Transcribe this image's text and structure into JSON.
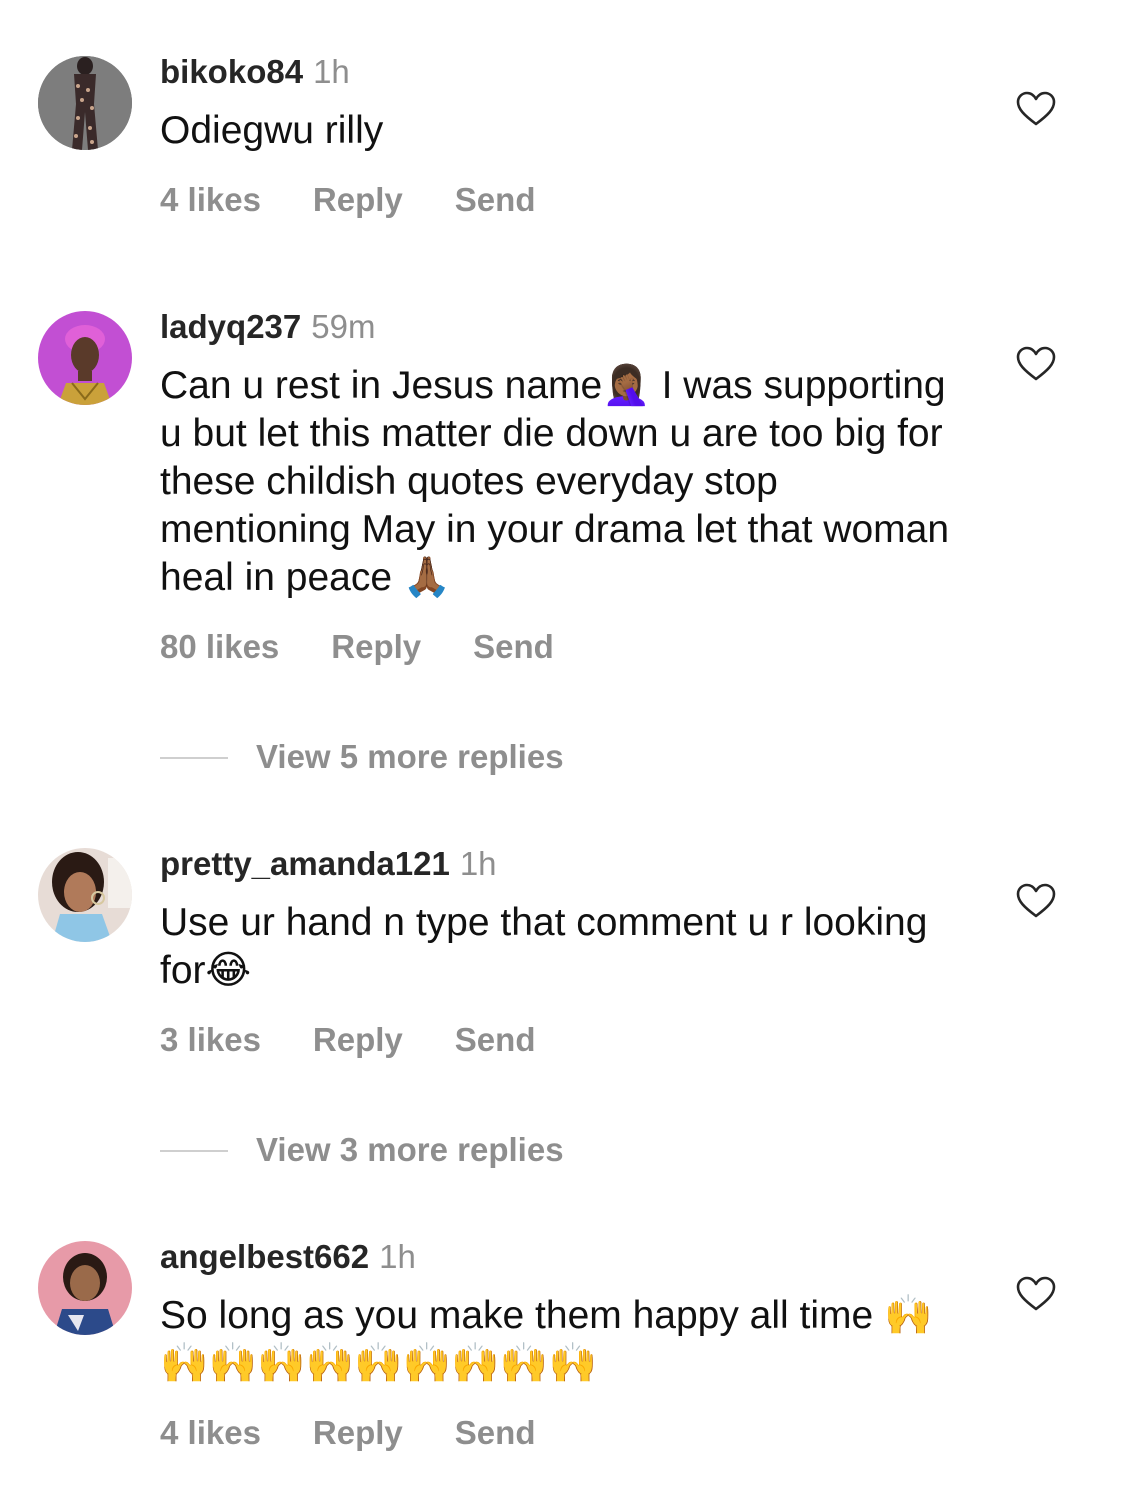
{
  "comments": [
    {
      "username": "bikoko84",
      "time": "1h",
      "text": "Odiegwu rilly",
      "likes": "4 likes",
      "reply": "Reply",
      "send": "Send"
    },
    {
      "username": "ladyq237",
      "time": "59m",
      "text_line1": "Can u rest in Jesus name",
      "emoji_facepalm": "🤦🏾‍♀️",
      "text_line1b": " I was",
      "text_rest": "supporting u but let this matter die down u are too big for these childish quotes everyday stop mentioning May in your drama let that woman heal in peace",
      "emoji_pray": "🙏🏾",
      "likes": "80 likes",
      "reply": "Reply",
      "send": "Send",
      "view_more": "View 5 more replies"
    },
    {
      "username": "pretty_amanda121",
      "time": "1h",
      "text": "Use ur hand n type that comment u r looking for",
      "emoji_laugh": "😂",
      "likes": "3 likes",
      "reply": "Reply",
      "send": "Send",
      "view_more": "View 3 more replies"
    },
    {
      "username": "angelbest662",
      "time": "1h",
      "text": "So long as you make them happy all time",
      "emoji_hands": "🙌🙌🙌🙌🙌🙌🙌🙌🙌🙌",
      "likes": "4 likes",
      "reply": "Reply",
      "send": "Send"
    }
  ],
  "icons": {
    "like": "heart-outline-icon"
  },
  "colors": {
    "username": "#262626",
    "muted": "#8e8e8e",
    "text": "#111111",
    "divider": "#cfcfcf"
  }
}
